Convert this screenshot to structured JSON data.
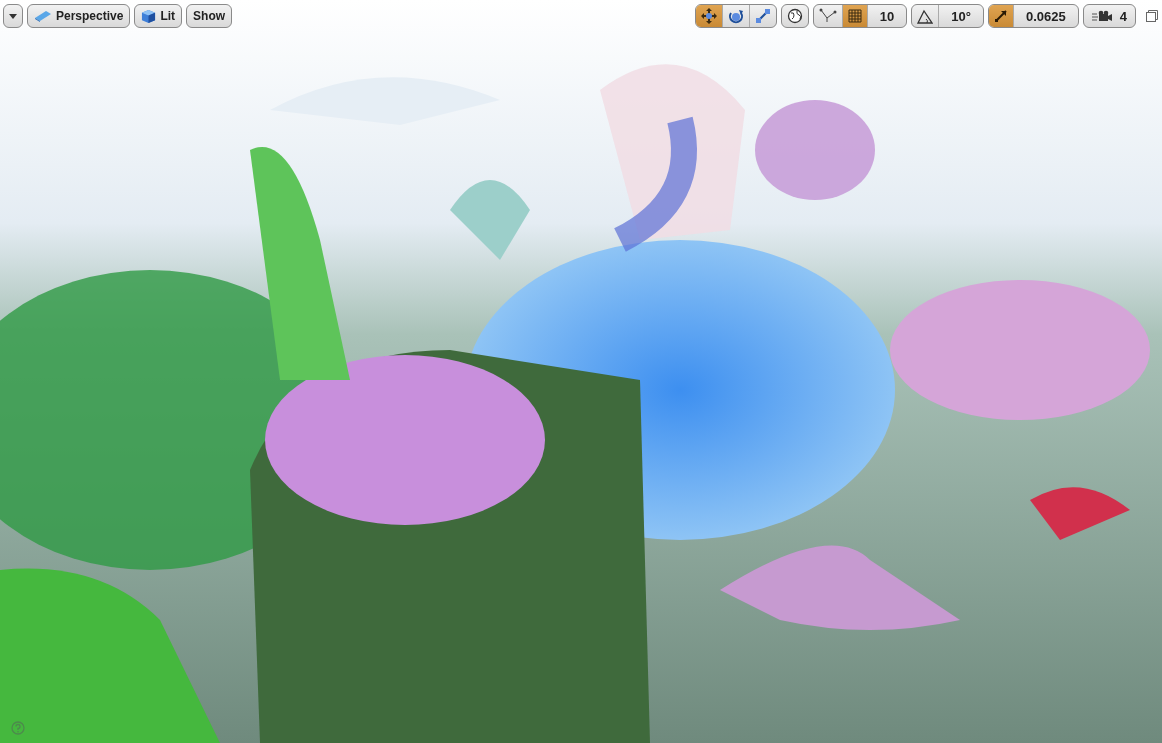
{
  "left_toolbar": {
    "buttons": [
      {
        "kind": "menu"
      },
      {
        "kind": "perspective",
        "label": "Perspective"
      },
      {
        "kind": "lit",
        "label": "Lit"
      },
      {
        "kind": "plain",
        "label": "Show"
      }
    ]
  },
  "right_toolbar": {
    "transform_modes": [
      {
        "kind": "translate",
        "selected": true
      },
      {
        "kind": "rotate",
        "selected": false
      },
      {
        "kind": "scale",
        "selected": false
      }
    ],
    "snaps": [
      {
        "kind": "grid",
        "on": true,
        "value": "10"
      },
      {
        "kind": "rotation",
        "on": false,
        "value": "10°"
      },
      {
        "kind": "scale",
        "on": true,
        "value": "0.0625"
      }
    ],
    "camera_speed": "4"
  }
}
